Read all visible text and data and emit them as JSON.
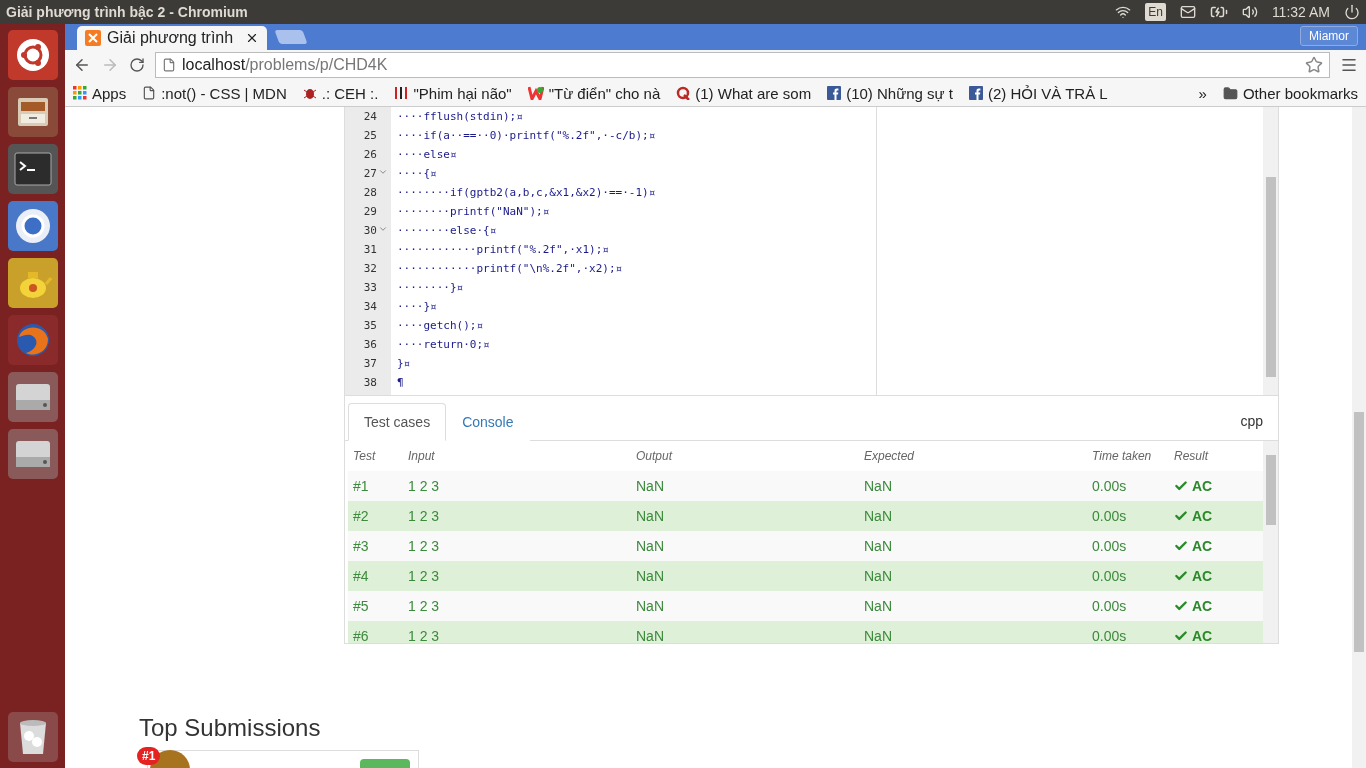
{
  "top_bar": {
    "window_title": "Giải phương trình bậc 2 - Chromium",
    "keyboard": "En",
    "clock": "11:32 AM"
  },
  "launcher": [
    {
      "kind": "ubuntu"
    },
    {
      "kind": "files"
    },
    {
      "kind": "terminal"
    },
    {
      "kind": "chromium"
    },
    {
      "kind": "teapot"
    },
    {
      "kind": "firefox"
    },
    {
      "kind": "drive"
    },
    {
      "kind": "drive"
    },
    {
      "kind": "trash"
    }
  ],
  "browser": {
    "tabs": [
      {
        "title": "Giải phương trình",
        "selected": true
      }
    ],
    "profile": "Miamor",
    "url_host": "localhost",
    "url_path": "/problems/p/CHD4K",
    "bookmarks": [
      {
        "label": "Apps",
        "kind": "apps"
      },
      {
        "label": ":not() - CSS | MDN",
        "kind": "page"
      },
      {
        "label": ".: CEH :.",
        "kind": "bug"
      },
      {
        "label": "\"Phim hại não\"",
        "kind": "ji"
      },
      {
        "label": "\"Từ điển\" cho nà",
        "kind": "w"
      },
      {
        "label": "(1) What are som",
        "kind": "q"
      },
      {
        "label": "(10) Những sự t",
        "kind": "fb"
      },
      {
        "label": "(2) HỎI VÀ TRẢ L",
        "kind": "fb"
      }
    ],
    "more_bookmarks": "»",
    "other_bookmarks": "Other bookmarks"
  },
  "editor": {
    "lines": [
      {
        "number": "24",
        "code": "····fflush(stdin);¤",
        "foldable": false
      },
      {
        "number": "25",
        "code": "····if(a··==··0)·printf(\"%.2f\",·-c/b);¤",
        "foldable": false
      },
      {
        "number": "26",
        "code": "····else¤",
        "foldable": false
      },
      {
        "number": "27",
        "code": "····{¤",
        "foldable": true
      },
      {
        "number": "28",
        "code": "········if(gptb2(a,b,c,&x1,&x2)·==·-1)¤",
        "foldable": false
      },
      {
        "number": "29",
        "code": "········printf(\"NaN\");¤",
        "foldable": false
      },
      {
        "number": "30",
        "code": "········else·{¤",
        "foldable": true
      },
      {
        "number": "31",
        "code": "············printf(\"%.2f\",·x1);¤",
        "foldable": false
      },
      {
        "number": "32",
        "code": "············printf(\"\\n%.2f\",·x2);¤",
        "foldable": false
      },
      {
        "number": "33",
        "code": "········}¤",
        "foldable": false
      },
      {
        "number": "34",
        "code": "····}¤",
        "foldable": false
      },
      {
        "number": "35",
        "code": "····getch();¤",
        "foldable": false
      },
      {
        "number": "36",
        "code": "····return·0;¤",
        "foldable": false
      },
      {
        "number": "37",
        "code": "}¤",
        "foldable": false
      },
      {
        "number": "38",
        "code": "¶",
        "foldable": false
      }
    ]
  },
  "panel_tabs": [
    {
      "label": "Test cases",
      "selected": true
    },
    {
      "label": "Console",
      "selected": false
    }
  ],
  "language": "cpp",
  "table": {
    "columns": [
      "Test",
      "Input",
      "Output",
      "Expected",
      "Time taken",
      "Result"
    ],
    "rows": [
      {
        "test": "#1",
        "input": "1 2 3",
        "output": "NaN",
        "expected": "NaN",
        "time": "0.00s",
        "result": "AC",
        "passed": true
      },
      {
        "test": "#2",
        "input": "1 2 3",
        "output": "NaN",
        "expected": "NaN",
        "time": "0.00s",
        "result": "AC",
        "passed": true
      },
      {
        "test": "#3",
        "input": "1 2 3",
        "output": "NaN",
        "expected": "NaN",
        "time": "0.00s",
        "result": "AC",
        "passed": true
      },
      {
        "test": "#4",
        "input": "1 2 3",
        "output": "NaN",
        "expected": "NaN",
        "time": "0.00s",
        "result": "AC",
        "passed": true
      },
      {
        "test": "#5",
        "input": "1 2 3",
        "output": "NaN",
        "expected": "NaN",
        "time": "0.00s",
        "result": "AC",
        "passed": true
      },
      {
        "test": "#6",
        "input": "1 2 3",
        "output": "NaN",
        "expected": "NaN",
        "time": "0.00s",
        "result": "AC",
        "passed": true
      }
    ]
  },
  "top_submissions": {
    "title": "Top Submissions",
    "rank": "#1"
  }
}
